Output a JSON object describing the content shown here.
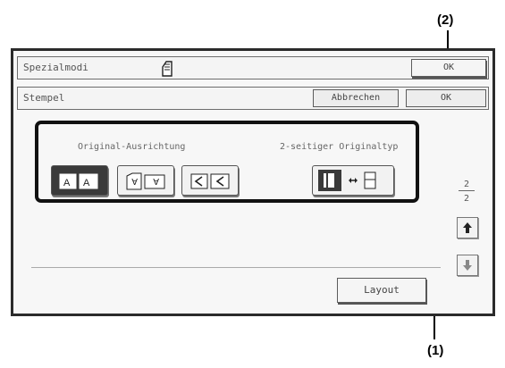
{
  "callouts": {
    "top": "(2)",
    "bottom": "(1)"
  },
  "topbar": {
    "title": "Spezialmodi",
    "ok_label": "OK",
    "icon": "document-icon"
  },
  "subbar": {
    "title": "Stempel",
    "cancel_label": "Abbrechen",
    "ok_label": "OK"
  },
  "orientation": {
    "label": "Original-Ausrichtung",
    "selected_index": 0
  },
  "duplex_type": {
    "label": "2-seitiger Originaltyp"
  },
  "pager": {
    "current": "2",
    "total": "2"
  },
  "layout_label": "Layout"
}
